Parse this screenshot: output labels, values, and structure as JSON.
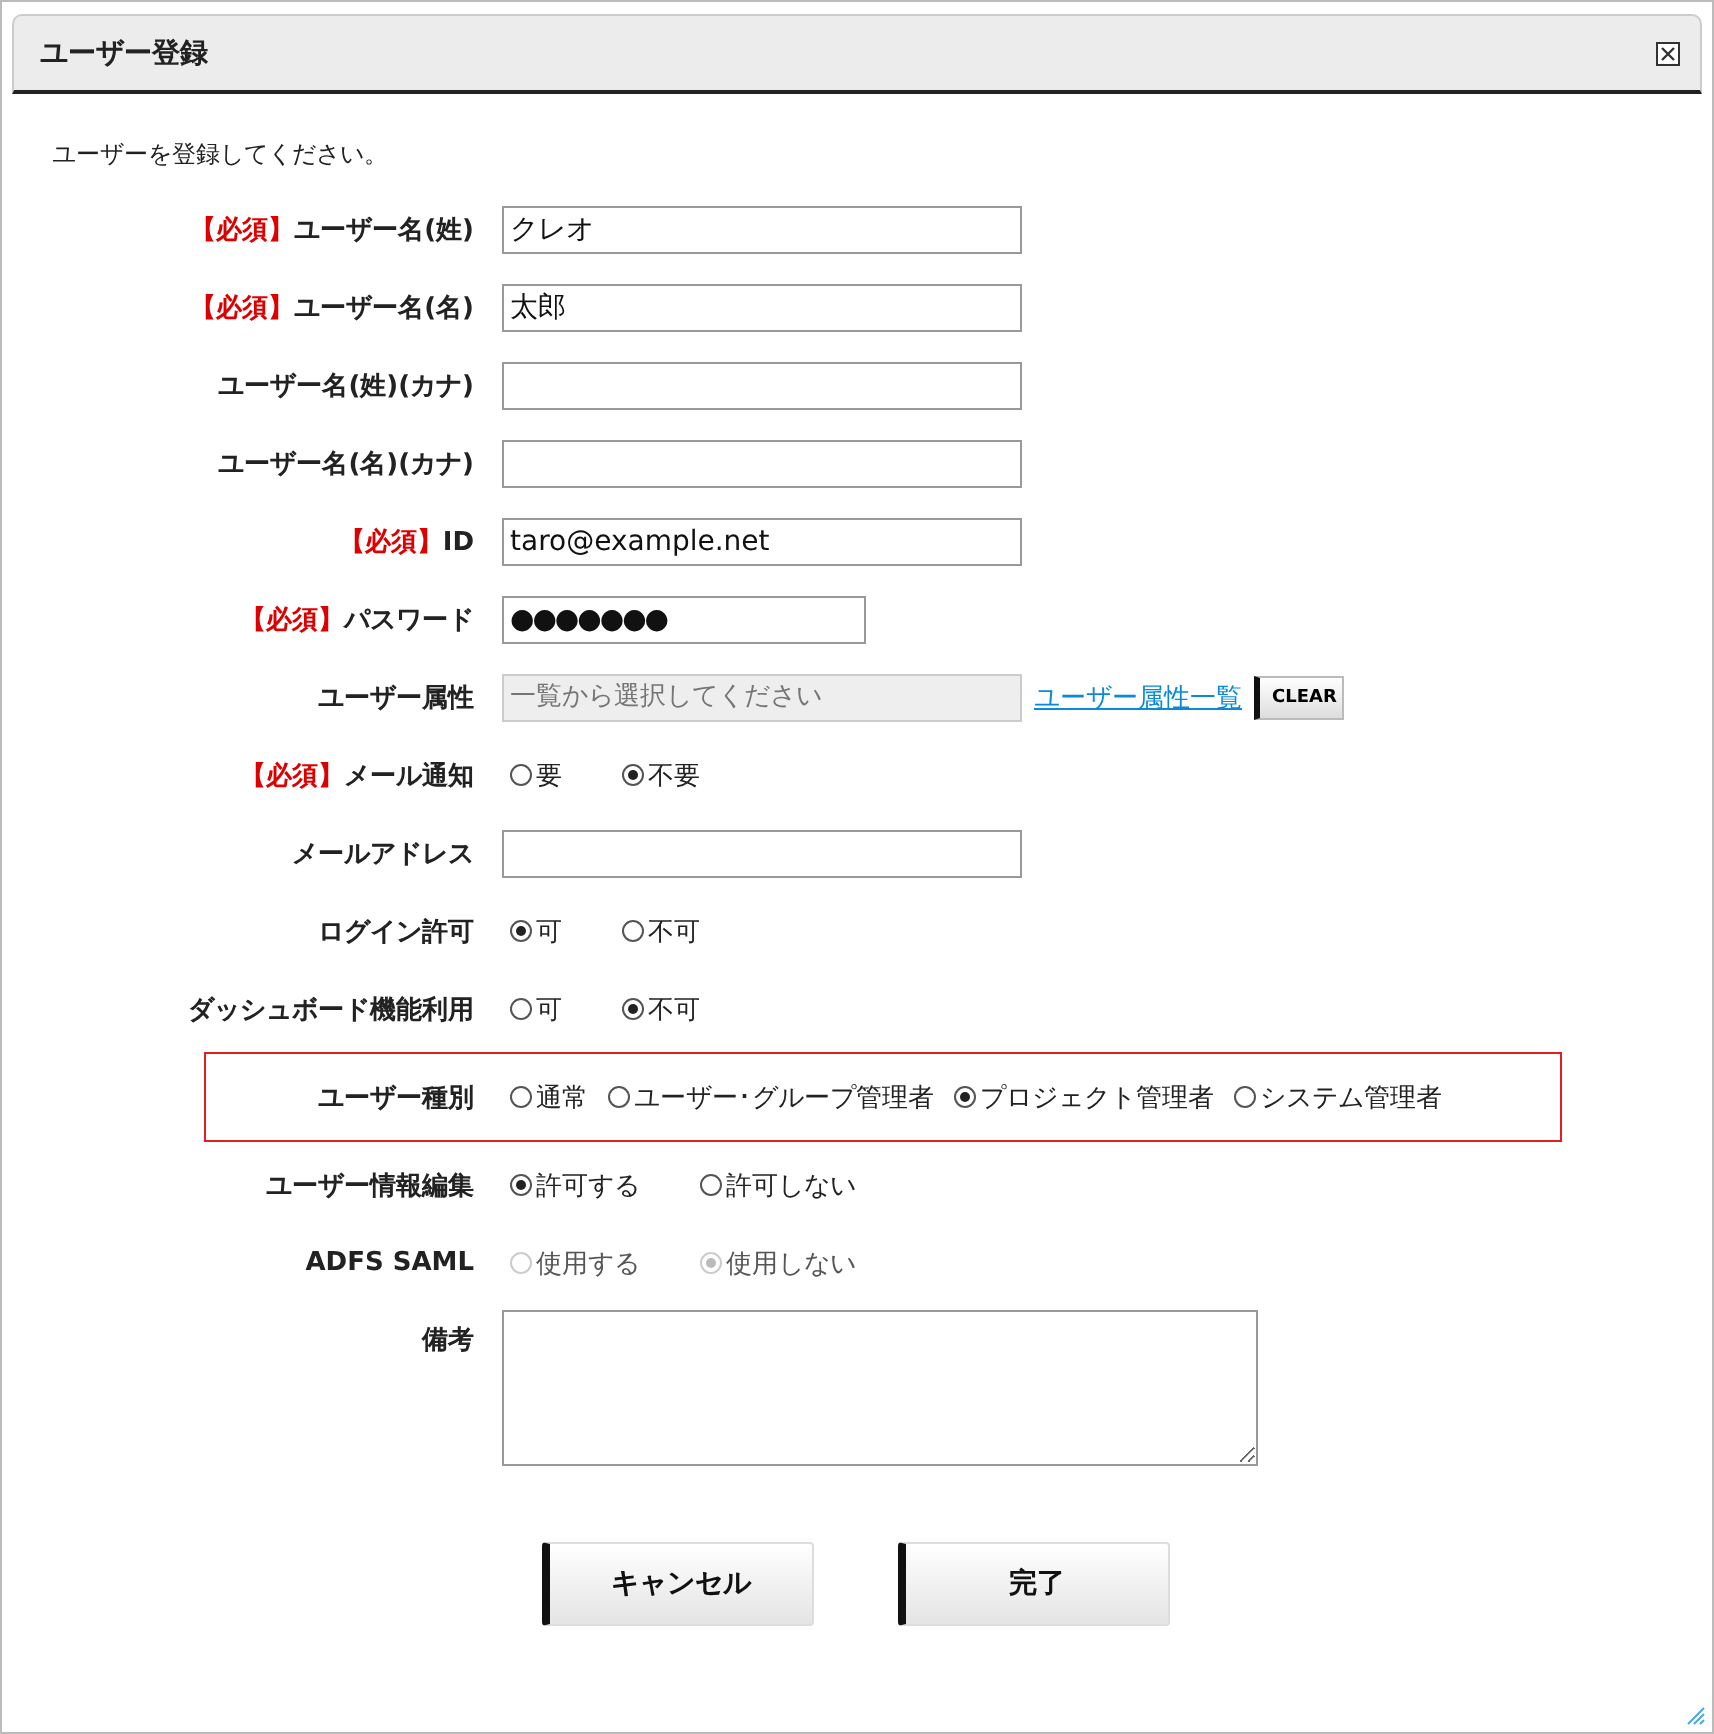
{
  "window": {
    "title": "ユーザー登録"
  },
  "description": "ユーザーを登録してください。",
  "fields": [
    {
      "kind": "text",
      "required_tag": "【必須】",
      "label": "ユーザー名(姓)",
      "value": "クレオ"
    },
    {
      "kind": "text",
      "required_tag": "【必須】",
      "label": "ユーザー名(名)",
      "value": "太郎"
    },
    {
      "kind": "text",
      "label": "ユーザー名(姓)(カナ)"
    },
    {
      "kind": "text",
      "label": "ユーザー名(名)(カナ)"
    },
    {
      "kind": "text",
      "required_tag": "【必須】",
      "label": "ID",
      "value": "taro@example.net"
    },
    {
      "kind": "password",
      "required_tag": "【必須】",
      "label": "パスワード",
      "value": "●●●●●●●"
    },
    {
      "kind": "picker",
      "label": "ユーザー属性",
      "placeholder": "一覧から選択してください",
      "link": "ユーザー属性一覧",
      "button": "CLEAR"
    },
    {
      "kind": "radio",
      "required_tag": "【必須】",
      "label": "メール通知",
      "options": [
        {
          "label": "要",
          "selected": false,
          "disabled": false
        },
        {
          "label": "不要",
          "selected": true,
          "disabled": false
        }
      ]
    },
    {
      "kind": "text",
      "label": "メールアドレス"
    },
    {
      "kind": "radio",
      "label": "ログイン許可",
      "options": [
        {
          "label": "可",
          "selected": true,
          "disabled": false
        },
        {
          "label": "不可",
          "selected": false,
          "disabled": false
        }
      ]
    },
    {
      "kind": "radio",
      "label": "ダッシュボード機能利用",
      "options": [
        {
          "label": "可",
          "selected": false,
          "disabled": false
        },
        {
          "label": "不可",
          "selected": true,
          "disabled": false
        }
      ]
    },
    {
      "kind": "radio",
      "label": "ユーザー種別",
      "highlighted": true,
      "options": [
        {
          "label": "通常",
          "selected": false,
          "disabled": false
        },
        {
          "label": "ユーザー･グループ管理者",
          "selected": false,
          "disabled": false
        },
        {
          "label": "プロジェクト管理者",
          "selected": true,
          "disabled": false
        },
        {
          "label": "システム管理者",
          "selected": false,
          "disabled": false
        }
      ]
    },
    {
      "kind": "radio",
      "label": "ユーザー情報編集",
      "options": [
        {
          "label": "許可する",
          "selected": true,
          "disabled": false
        },
        {
          "label": "許可しない",
          "selected": false,
          "disabled": false
        }
      ]
    },
    {
      "kind": "radio",
      "label": "ADFS SAML",
      "options": [
        {
          "label": "使用する",
          "selected": false,
          "disabled": true
        },
        {
          "label": "使用しない",
          "selected": true,
          "disabled": true
        }
      ]
    },
    {
      "kind": "textarea",
      "label": "備考"
    }
  ],
  "buttons": [
    "キャンセル",
    "完了"
  ]
}
